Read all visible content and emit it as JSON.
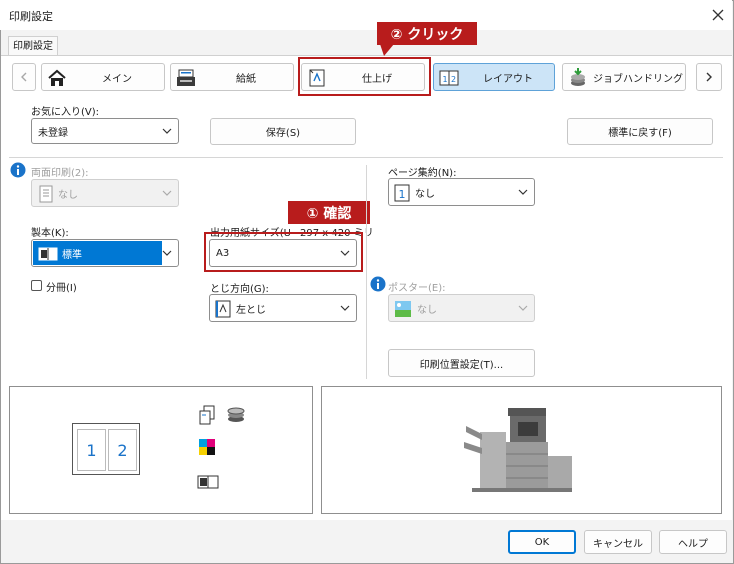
{
  "window": {
    "title": "印刷設定"
  },
  "tab": {
    "label": "印刷設定"
  },
  "nav": {
    "items": [
      {
        "label": "メイン"
      },
      {
        "label": "給紙"
      },
      {
        "label": "仕上げ"
      },
      {
        "label": "レイアウト"
      },
      {
        "label": "ジョブハンドリング"
      }
    ]
  },
  "favorites": {
    "label": "お気に入り(V):",
    "value": "未登録",
    "save_label": "保存(S)",
    "reset_label": "標準に戻す(F)"
  },
  "duplex": {
    "label": "両面印刷(2):",
    "value": "なし"
  },
  "binding": {
    "label": "製本(K):",
    "value": "標準",
    "split_label": "分冊(I)"
  },
  "paper_size": {
    "label": "出力用紙サイズ(U",
    "hint": "297 x 420 ミリ",
    "value": "A3"
  },
  "binding_edge": {
    "label": "とじ方向(G):",
    "value": "左とじ"
  },
  "nup": {
    "label": "ページ集約(N):",
    "value": "なし"
  },
  "poster": {
    "label": "ポスター(E):",
    "value": "なし"
  },
  "print_position_label": "印刷位置設定(T)...",
  "preview": {
    "page1": "1",
    "page2": "2"
  },
  "footer": {
    "ok": "OK",
    "cancel": "キャンセル",
    "help": "ヘルプ"
  },
  "annotations": {
    "step1": "① 確認",
    "step2": "② クリック"
  },
  "colors": {
    "accent": "#0078d4",
    "callout": "#b81c1c",
    "selected_tab": "#cce4f7"
  }
}
